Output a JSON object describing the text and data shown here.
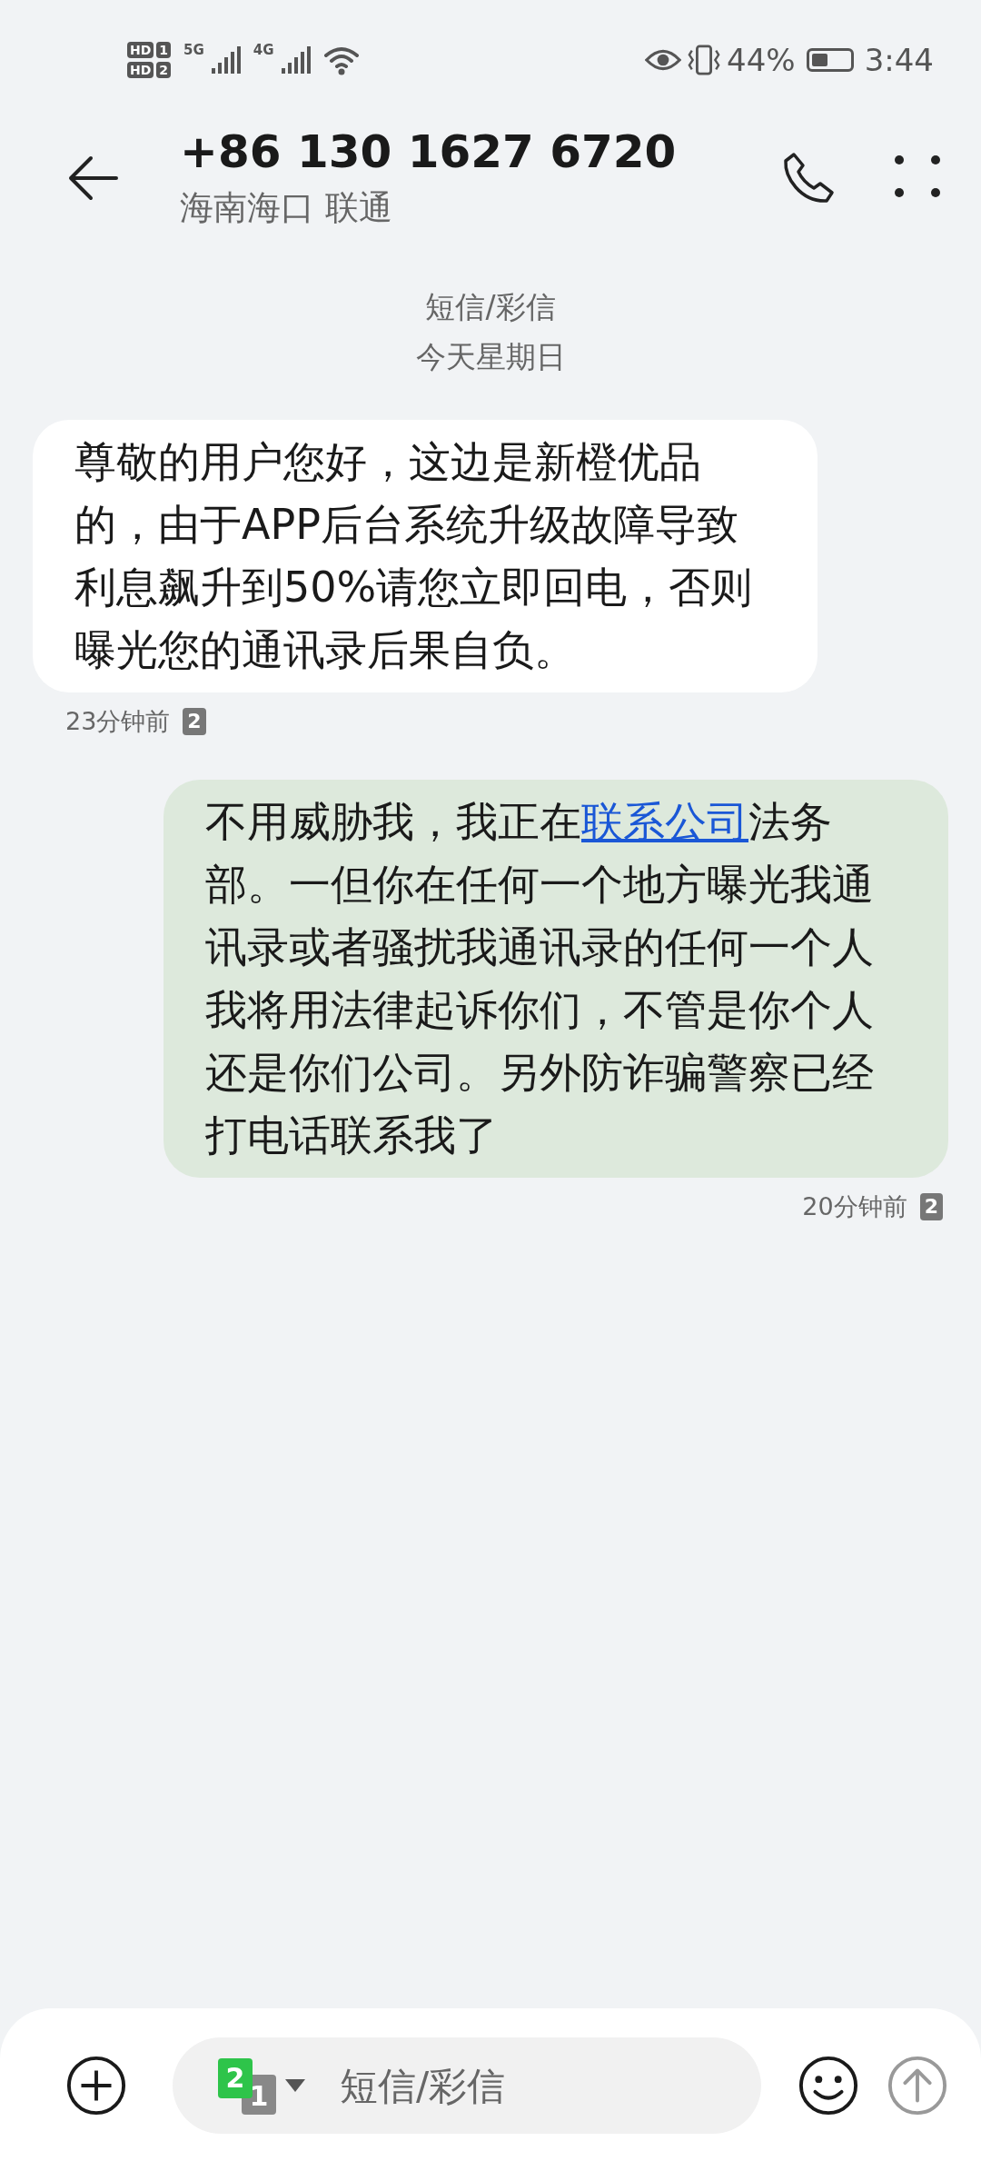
{
  "status_bar": {
    "sims": [
      {
        "tag": "HD",
        "slot": "1"
      },
      {
        "tag": "HD",
        "slot": "2"
      }
    ],
    "networks": [
      {
        "label": "5G"
      },
      {
        "label": "4G"
      }
    ],
    "battery_text": "44%",
    "time": "3:44"
  },
  "header": {
    "title": "+86 130 1627 6720",
    "subtitle": "海南海口 联通"
  },
  "thread": {
    "type_label": "短信/彩信",
    "date": "今天星期日"
  },
  "messages": [
    {
      "kind": "in",
      "text": "尊敬的用户您好，这边是新橙优品的，由于APP后台系统升级故障导致利息飙升到50%请您立即回电，否则曝光您的通讯录后果自负。",
      "time": "23分钟前",
      "sim": "2"
    },
    {
      "kind": "out",
      "text_before": "不用威胁我，我正在",
      "link": "联系公司",
      "text_after": "法务部。一但你在任何一个地方曝光我通讯录或者骚扰我通讯录的任何一个人我将用法律起诉你们，不管是你个人还是你们公司。另外防诈骗警察已经打电话联系我了",
      "time": "20分钟前",
      "sim": "2"
    }
  ],
  "composer": {
    "sim_front": "2",
    "sim_back": "1",
    "placeholder": "短信/彩信"
  }
}
